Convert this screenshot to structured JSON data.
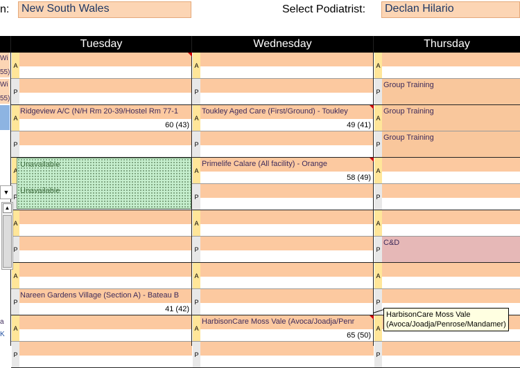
{
  "header": {
    "region_label_fragment": "n:",
    "region_value": "New South Wales",
    "podiatrist_label": "Select Podiatrist:",
    "podiatrist_value": "Declan Hilario"
  },
  "days": [
    "Tuesday",
    "Wednesday",
    "Thursday"
  ],
  "slot_markers": {
    "am": "A",
    "pm": "P"
  },
  "left_fragments": [
    "Wi",
    "55)",
    "Wi",
    "55)",
    "a",
    "K"
  ],
  "tuesday": {
    "ridgeview": "Ridgeview A/C (N/H Rm 20-39/Hostel Rm 77-1",
    "ridgeview_count": "60 (43)",
    "unavailable_1": "Unavailable",
    "unavailable_2": "Unavailable",
    "nareen": "Nareen Gardens Village (Section A) - Bateau B",
    "nareen_count": "41 (42)"
  },
  "wednesday": {
    "toukley": "Toukley Aged Care (First/Ground) - Toukley",
    "toukley_count": "49 (41)",
    "primelife": "Primelife Calare (All facility) - Orange",
    "primelife_count": "58 (49)",
    "harbison": "HarbisonCare Moss Vale (Avoca/Joadja/Penr",
    "harbison_count": "65 (50)"
  },
  "thursday": {
    "group_training_1": "Group Training",
    "group_training_2": "Group Training",
    "group_training_3": "Group Training",
    "cd": "C&D"
  },
  "tooltip": {
    "line1": "HarbisonCare Moss Vale",
    "line2": "(Avoca/Joadja/Penrose/Mandamer)"
  }
}
